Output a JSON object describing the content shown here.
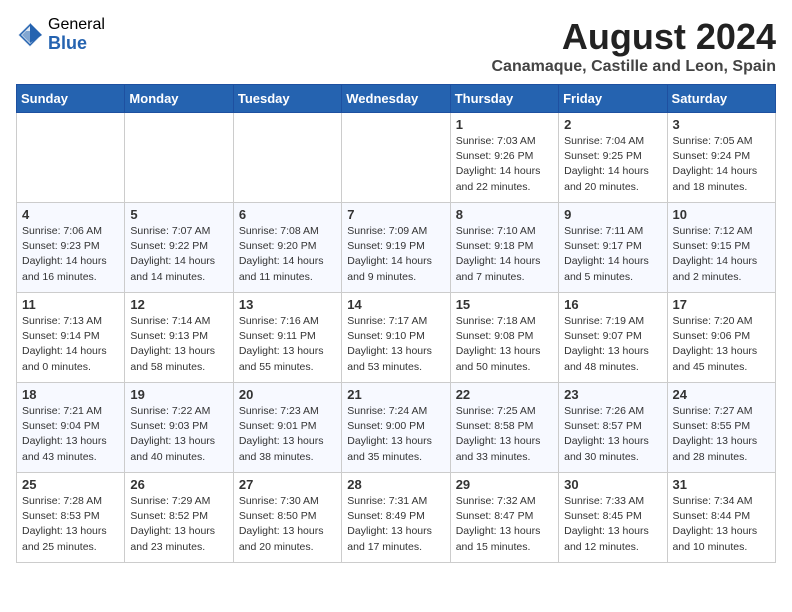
{
  "header": {
    "logo_general": "General",
    "logo_blue": "Blue",
    "title": "August 2024",
    "subtitle": "Canamaque, Castille and Leon, Spain"
  },
  "calendar": {
    "days_of_week": [
      "Sunday",
      "Monday",
      "Tuesday",
      "Wednesday",
      "Thursday",
      "Friday",
      "Saturday"
    ],
    "weeks": [
      [
        {
          "day": "",
          "info": ""
        },
        {
          "day": "",
          "info": ""
        },
        {
          "day": "",
          "info": ""
        },
        {
          "day": "",
          "info": ""
        },
        {
          "day": "1",
          "info": "Sunrise: 7:03 AM\nSunset: 9:26 PM\nDaylight: 14 hours\nand 22 minutes."
        },
        {
          "day": "2",
          "info": "Sunrise: 7:04 AM\nSunset: 9:25 PM\nDaylight: 14 hours\nand 20 minutes."
        },
        {
          "day": "3",
          "info": "Sunrise: 7:05 AM\nSunset: 9:24 PM\nDaylight: 14 hours\nand 18 minutes."
        }
      ],
      [
        {
          "day": "4",
          "info": "Sunrise: 7:06 AM\nSunset: 9:23 PM\nDaylight: 14 hours\nand 16 minutes."
        },
        {
          "day": "5",
          "info": "Sunrise: 7:07 AM\nSunset: 9:22 PM\nDaylight: 14 hours\nand 14 minutes."
        },
        {
          "day": "6",
          "info": "Sunrise: 7:08 AM\nSunset: 9:20 PM\nDaylight: 14 hours\nand 11 minutes."
        },
        {
          "day": "7",
          "info": "Sunrise: 7:09 AM\nSunset: 9:19 PM\nDaylight: 14 hours\nand 9 minutes."
        },
        {
          "day": "8",
          "info": "Sunrise: 7:10 AM\nSunset: 9:18 PM\nDaylight: 14 hours\nand 7 minutes."
        },
        {
          "day": "9",
          "info": "Sunrise: 7:11 AM\nSunset: 9:17 PM\nDaylight: 14 hours\nand 5 minutes."
        },
        {
          "day": "10",
          "info": "Sunrise: 7:12 AM\nSunset: 9:15 PM\nDaylight: 14 hours\nand 2 minutes."
        }
      ],
      [
        {
          "day": "11",
          "info": "Sunrise: 7:13 AM\nSunset: 9:14 PM\nDaylight: 14 hours\nand 0 minutes."
        },
        {
          "day": "12",
          "info": "Sunrise: 7:14 AM\nSunset: 9:13 PM\nDaylight: 13 hours\nand 58 minutes."
        },
        {
          "day": "13",
          "info": "Sunrise: 7:16 AM\nSunset: 9:11 PM\nDaylight: 13 hours\nand 55 minutes."
        },
        {
          "day": "14",
          "info": "Sunrise: 7:17 AM\nSunset: 9:10 PM\nDaylight: 13 hours\nand 53 minutes."
        },
        {
          "day": "15",
          "info": "Sunrise: 7:18 AM\nSunset: 9:08 PM\nDaylight: 13 hours\nand 50 minutes."
        },
        {
          "day": "16",
          "info": "Sunrise: 7:19 AM\nSunset: 9:07 PM\nDaylight: 13 hours\nand 48 minutes."
        },
        {
          "day": "17",
          "info": "Sunrise: 7:20 AM\nSunset: 9:06 PM\nDaylight: 13 hours\nand 45 minutes."
        }
      ],
      [
        {
          "day": "18",
          "info": "Sunrise: 7:21 AM\nSunset: 9:04 PM\nDaylight: 13 hours\nand 43 minutes."
        },
        {
          "day": "19",
          "info": "Sunrise: 7:22 AM\nSunset: 9:03 PM\nDaylight: 13 hours\nand 40 minutes."
        },
        {
          "day": "20",
          "info": "Sunrise: 7:23 AM\nSunset: 9:01 PM\nDaylight: 13 hours\nand 38 minutes."
        },
        {
          "day": "21",
          "info": "Sunrise: 7:24 AM\nSunset: 9:00 PM\nDaylight: 13 hours\nand 35 minutes."
        },
        {
          "day": "22",
          "info": "Sunrise: 7:25 AM\nSunset: 8:58 PM\nDaylight: 13 hours\nand 33 minutes."
        },
        {
          "day": "23",
          "info": "Sunrise: 7:26 AM\nSunset: 8:57 PM\nDaylight: 13 hours\nand 30 minutes."
        },
        {
          "day": "24",
          "info": "Sunrise: 7:27 AM\nSunset: 8:55 PM\nDaylight: 13 hours\nand 28 minutes."
        }
      ],
      [
        {
          "day": "25",
          "info": "Sunrise: 7:28 AM\nSunset: 8:53 PM\nDaylight: 13 hours\nand 25 minutes."
        },
        {
          "day": "26",
          "info": "Sunrise: 7:29 AM\nSunset: 8:52 PM\nDaylight: 13 hours\nand 23 minutes."
        },
        {
          "day": "27",
          "info": "Sunrise: 7:30 AM\nSunset: 8:50 PM\nDaylight: 13 hours\nand 20 minutes."
        },
        {
          "day": "28",
          "info": "Sunrise: 7:31 AM\nSunset: 8:49 PM\nDaylight: 13 hours\nand 17 minutes."
        },
        {
          "day": "29",
          "info": "Sunrise: 7:32 AM\nSunset: 8:47 PM\nDaylight: 13 hours\nand 15 minutes."
        },
        {
          "day": "30",
          "info": "Sunrise: 7:33 AM\nSunset: 8:45 PM\nDaylight: 13 hours\nand 12 minutes."
        },
        {
          "day": "31",
          "info": "Sunrise: 7:34 AM\nSunset: 8:44 PM\nDaylight: 13 hours\nand 10 minutes."
        }
      ]
    ]
  }
}
